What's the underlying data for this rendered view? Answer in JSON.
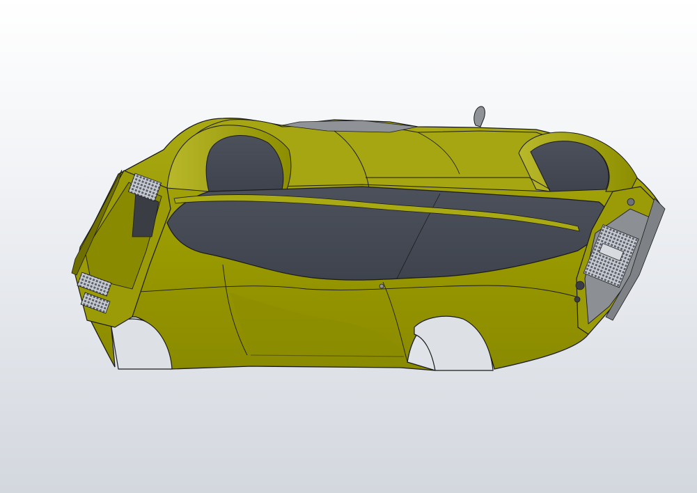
{
  "viewport": {
    "background_top": "#ffffff",
    "background_bottom": "#d3d7de"
  },
  "model": {
    "body_color": "#9a9a00",
    "body_shadow_color": "#7d7d00",
    "body_highlight_color": "#b4b41e",
    "interior_color": "#454a55",
    "edge_color": "#1a1a1a"
  }
}
